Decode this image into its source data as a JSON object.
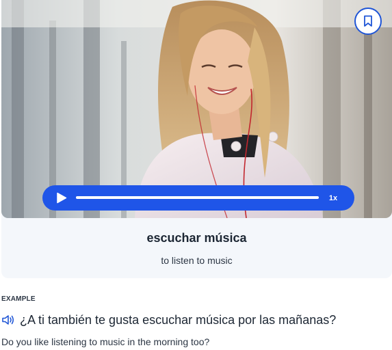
{
  "card": {
    "word": "escuchar música",
    "translation": "to listen to music",
    "image_icon": "photo-woman-with-earphones",
    "bookmark_icon": "bookmark-icon",
    "player": {
      "play_icon": "play-icon",
      "speed": "1x",
      "progress": 0
    }
  },
  "example": {
    "label": "EXAMPLE",
    "speaker_icon": "speaker-icon",
    "sentence": "¿A ti también te gusta escuchar música por las mañanas?",
    "translation": "Do you like listening to music in the morning too?"
  },
  "colors": {
    "accent": "#1f55e8",
    "card_bg": "#f4f7fb"
  }
}
